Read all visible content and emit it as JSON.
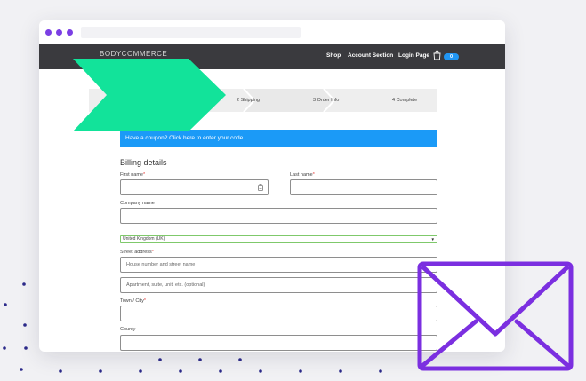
{
  "header": {
    "brand": "BODYCOMMERCE",
    "nav": [
      "Shop",
      "Account Section",
      "Login Page"
    ],
    "cart_count": "0"
  },
  "steps": [
    {
      "label": "2  Shipping"
    },
    {
      "label": "3  Order Info"
    },
    {
      "label": "4  Complete"
    }
  ],
  "coupon": {
    "text": "Have a coupon? Click here to enter your code"
  },
  "billing": {
    "title": "Billing details",
    "first_name": "First name",
    "last_name": "Last name",
    "company": "Company name",
    "country_value": "United Kingdom (UK)",
    "street": "Street address",
    "street_placeholder": "House number and street name",
    "apartment_placeholder": "Apartment, suite, unit, etc. (optional)",
    "town": "Town / City",
    "county": "County",
    "required_mark": "*"
  },
  "colors": {
    "accent_purple": "#7b3fe4",
    "chevron_green": "#12e39a",
    "coupon_blue": "#1b9af7",
    "nav_dark": "#3a3a3e"
  },
  "icons": [
    "shopping-bag-icon",
    "field-autofill-icon",
    "chevron-arrow-icon",
    "envelope-icon"
  ]
}
